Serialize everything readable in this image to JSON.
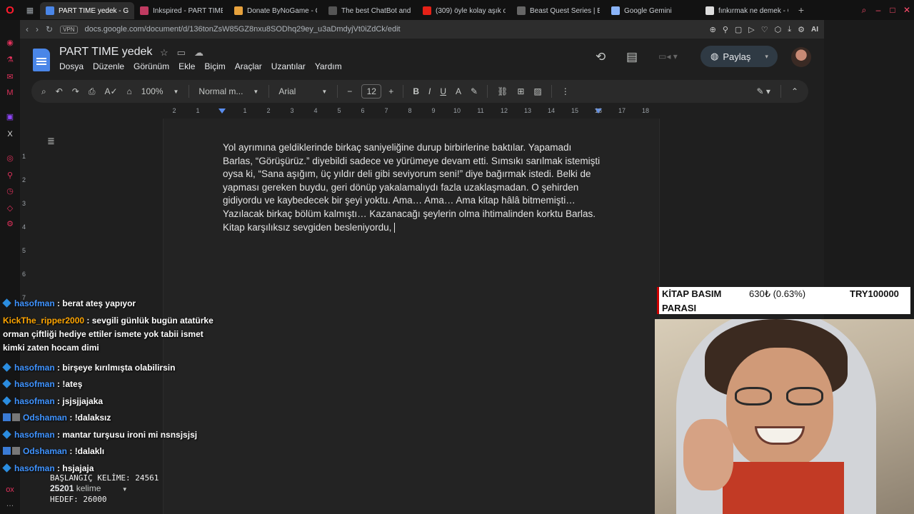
{
  "browser": {
    "tabs": [
      {
        "label": "PART TIME yedek - Google",
        "fav": "docs-icon",
        "color": "#4a86e8"
      },
      {
        "label": "Inkspired - PART TIME",
        "fav": "inkspired-icon",
        "color": "#c03b61"
      },
      {
        "label": "Donate ByNoGame - C",
        "fav": "bynogame-icon",
        "color": "#e7a23d"
      },
      {
        "label": "The best ChatBot and",
        "fav": "chatbot-icon",
        "color": "#555555"
      },
      {
        "label": "(309) öyle kolay aşık o",
        "fav": "youtube-icon",
        "color": "#e62117"
      },
      {
        "label": "Beast Quest Series | B",
        "fav": "beastquest-icon",
        "color": "#666666"
      },
      {
        "label": "Google Gemini",
        "fav": "gemini-icon",
        "color": "#8ab4f8"
      },
      {
        "label": "fınkırmak ne demek - G",
        "fav": "google-icon",
        "color": "#dddddd"
      }
    ],
    "url": "docs.google.com/document/d/136tonZsW85GZ8nxu8SODhq29ey_u3aDmdyjVt0iZdCk/edit",
    "vpn_label": "VPN",
    "ai_label": "AI"
  },
  "docs": {
    "title": "PART TIME yedek",
    "menu": [
      "Dosya",
      "Düzenle",
      "Görünüm",
      "Ekle",
      "Biçim",
      "Araçlar",
      "Uzantılar",
      "Yardım"
    ],
    "share_label": "Paylaş",
    "toolbar": {
      "zoom": "100%",
      "style": "Normal m...",
      "font": "Arial",
      "font_size": "12"
    },
    "ruler_numbers": [
      "2",
      "1",
      "1",
      "2",
      "3",
      "4",
      "5",
      "6",
      "7",
      "8",
      "9",
      "10",
      "11",
      "12",
      "13",
      "14",
      "15",
      "16",
      "17",
      "18"
    ],
    "vruler_numbers": [
      "1",
      "2",
      "3",
      "4",
      "5",
      "6",
      "7"
    ],
    "body_text": "Yol ayrımına geldiklerinde birkaç saniyeliğine durup birbirlerine baktılar. Yapamadı Barlas, “Görüşürüz.” diyebildi sadece ve yürümeye devam etti. Sımsıkı sarılmak istemişti oysa ki, “Sana aşığım, üç yıldır deli gibi seviyorum seni!” diye bağırmak istedi. Belki de yapması gereken buydu, geri dönüp yakalamalıydı fazla uzaklaşmadan. O şehirden gidiyordu ve kaybedecek bir şeyi yoktu. Ama… Ama… Ama kitap hâlâ bitmemişti… Yazılacak birkaç bölüm kalmıştı… Kazanacağı şeylerin olma ihtimalinden korktu Barlas. Kitap karşılıksız sevgiden besleniyordu,"
  },
  "chat": [
    {
      "user": "hasofman",
      "text": ": berat ateş yapıyor",
      "color": "blue"
    },
    {
      "user": "KickThe_ripper2000",
      "text": ": sevgili günlük bugün atatürke orman çiftliği hediye ettiler ismete yok tabii ismet kimki zaten hocam dimi",
      "color": "orange"
    },
    {
      "user": "hasofman",
      "text": ": birşeye kırılmışta olabilirsin",
      "color": "blue"
    },
    {
      "user": "hasofman",
      "text": ": !ateş",
      "color": "blue"
    },
    {
      "user": "hasofman",
      "text": ": jsjsjjajaka",
      "color": "blue"
    },
    {
      "user": "Odshaman",
      "text": ": !dalaksız",
      "color": "blue"
    },
    {
      "user": "hasofman",
      "text": ": mantar turşusu ironi mi nsnsjsjsj",
      "color": "blue"
    },
    {
      "user": "Odshaman",
      "text": ": !dalaklı",
      "color": "blue"
    },
    {
      "user": "hasofman",
      "text": ": hsjajaja",
      "color": "blue"
    }
  ],
  "counter": {
    "start_label": "BAŞLANGIÇ KELİME: 24561",
    "words_value": "25201",
    "words_unit": "kelime",
    "target_label": "HEDEF: 26000"
  },
  "ticker": {
    "label_line1": "KİTAP BASIM",
    "label_line2": "PARASI",
    "value": "630₺ (0.63%)",
    "target": "TRY100000"
  }
}
